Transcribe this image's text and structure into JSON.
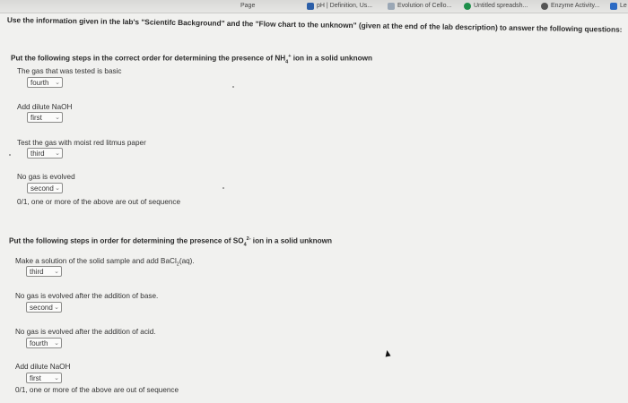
{
  "tabs": [
    {
      "label": "Page",
      "icon": "page-icon"
    },
    {
      "label": "pH | Definition, Us...",
      "icon": "web-page-icon"
    },
    {
      "label": "Evolution of Cello...",
      "icon": "web-page-icon"
    },
    {
      "label": "Untitled spreadsh...",
      "icon": "spreadsheet-icon"
    },
    {
      "label": "Enzyme Activity...",
      "icon": "web-page-icon"
    },
    {
      "label": "Le",
      "icon": "bookmark-icon"
    }
  ],
  "instruction": "Use the information given in the lab's \"Scientifc Background\" and the \"Flow chart to the unknown\" (given at the end of the lab description) to answer the following questions:",
  "q1": {
    "title_pre": "Put the following steps in the correct order for determining the presence of NH",
    "title_sub": "4",
    "title_sup": "+",
    "title_post": " ion in a solid unknown",
    "steps": [
      {
        "label": "The gas that was tested is basic",
        "value": "fourth"
      },
      {
        "label": "Add dilute NaOH",
        "value": "first"
      },
      {
        "label": "Test the gas with moist red litmus paper",
        "value": "third"
      },
      {
        "label": "No gas is evolved",
        "value": "second"
      }
    ],
    "score": "0/1, one or more of the above are out of sequence"
  },
  "q2": {
    "title_pre": "Put the following steps in order for determining the presence of SO",
    "title_sub": "4",
    "title_sup": "2-",
    "title_post": " ion in a solid unknown",
    "steps": [
      {
        "label_pre": "Make a solution of the solid sample and add BaCl",
        "label_sub": "2",
        "label_post": "(aq).",
        "value": "third"
      },
      {
        "label": "No gas is evolved after the addition of base.",
        "value": "second"
      },
      {
        "label": "No gas is evolved after the addition of acid.",
        "value": "fourth"
      },
      {
        "label": "Add dilute NaOH",
        "value": "first"
      }
    ],
    "score": "0/1, one or more of the above are out of sequence"
  }
}
